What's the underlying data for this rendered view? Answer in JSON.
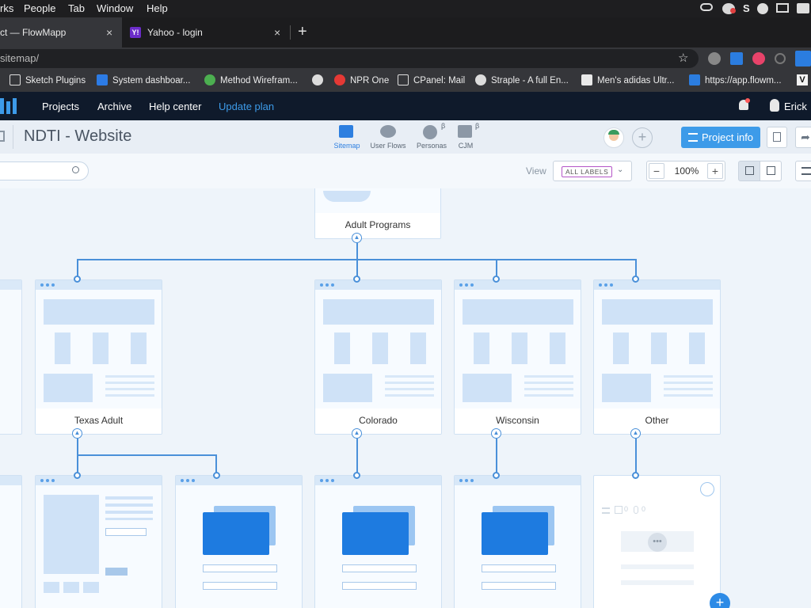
{
  "menubar": {
    "items": [
      "rks",
      "People",
      "Tab",
      "Window",
      "Help"
    ]
  },
  "tabs": [
    {
      "title": "ct — FlowMapp",
      "close": "×"
    },
    {
      "title": "Yahoo - login",
      "close": "×"
    }
  ],
  "new_tab": "+",
  "address": {
    "url": "sitemap/"
  },
  "bookmarks": [
    {
      "label": "Sketch Plugins",
      "icon": "folder-icon"
    },
    {
      "label": "System dashboar...",
      "icon": "jira-icon"
    },
    {
      "label": "Method Wirefram...",
      "icon": "leaf-icon"
    },
    {
      "label": "",
      "icon": "globe-icon"
    },
    {
      "label": "NPR One",
      "icon": "npr-icon"
    },
    {
      "label": "CPanel: Mail",
      "icon": "folder-icon"
    },
    {
      "label": "Straple - A full En...",
      "icon": "globe-icon"
    },
    {
      "label": "Men's adidas Ultr...",
      "icon": "adidas-icon"
    },
    {
      "label": "https://app.flowm...",
      "icon": "flowmapp-icon"
    }
  ],
  "appnav": {
    "items": [
      "Projects",
      "Archive",
      "Help center"
    ],
    "update": "Update plan",
    "user": "Erick",
    "accent": "#3d9be9"
  },
  "project": {
    "title": "NDTI - Website",
    "modes": [
      {
        "label": "Sitemap",
        "beta": ""
      },
      {
        "label": "User Flows",
        "beta": ""
      },
      {
        "label": "Personas",
        "beta": "β"
      },
      {
        "label": "CJM",
        "beta": "β"
      }
    ],
    "info_button": "Project info"
  },
  "toolbar": {
    "view_label": "View",
    "labels_select": "ALL LABELS",
    "zoom": "100%",
    "zoom_minus": "−",
    "zoom_plus": "+"
  },
  "sitemap": {
    "root": "Adult Programs",
    "level2": [
      "Texas Adult",
      "Colorado",
      "Wisconsin",
      "Other"
    ],
    "placeholder_counts": {
      "notes": "0",
      "files": "0"
    },
    "add": "+"
  }
}
